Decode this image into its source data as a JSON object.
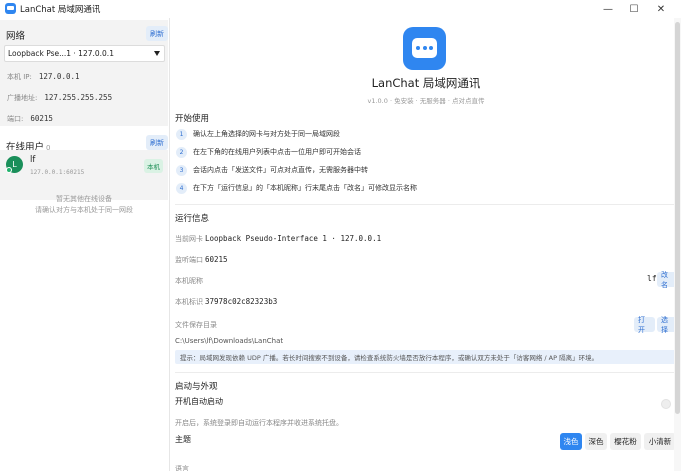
{
  "window": {
    "title": "LanChat 局域网通讯",
    "min_glyph": "—",
    "max_glyph": "☐",
    "close_glyph": "✕"
  },
  "colors": {
    "accent": "#2f86f0",
    "online": "#23b36e",
    "tip_bg": "#e8f0fb"
  },
  "icons": {
    "app": "chat-bubble-icon",
    "dropdown": "caret-down-icon"
  },
  "sidebar": {
    "network": {
      "title": "网络",
      "refresh": "刷新",
      "selected_interface": "Loopback Pse...1 · 127.0.0.1",
      "local_ip_label": "本机 IP:",
      "local_ip": "127.0.0.1",
      "broadcast_label": "广播地址:",
      "broadcast": "127.255.255.255",
      "port_label": "端口:",
      "port": "60215"
    },
    "online": {
      "title": "在线用户",
      "count": "0",
      "refresh": "刷新",
      "user": {
        "avatar_letter": "L",
        "name": "lf",
        "address": "127.0.0.1:60215",
        "badge": "本机"
      },
      "empty_line1": "暂无其他在线设备",
      "empty_line2": "请确认对方与本机处于同一网段"
    }
  },
  "main": {
    "app_name": "LanChat 局域网通讯",
    "version_line": "v1.0.0 · 免安装 · 无服务器 · 点对点直传",
    "getting_started": {
      "title": "开始使用",
      "steps": [
        {
          "num": "1",
          "text": "确认左上角选择的网卡与对方处于同一局域网段"
        },
        {
          "num": "2",
          "text": "在左下角的在线用户列表中点击一位用户即可开始会话"
        },
        {
          "num": "3",
          "text": "会话内点击「发送文件」可点对点直传，无需服务器中转"
        },
        {
          "num": "4",
          "text": "在下方「运行信息」的「本机昵称」行末尾点击「改名」可修改显示名称"
        }
      ]
    },
    "runtime": {
      "title": "运行信息",
      "nic_label": "当前网卡",
      "nic_value": "Loopback Pseudo-Interface 1 · 127.0.0.1",
      "port_label": "监听端口",
      "port_value": "60215",
      "nickname_label": "本机昵称",
      "nickname_value": "lf",
      "rename": "改名",
      "id_label": "本机标识",
      "id_value": "37978c02c82323b3",
      "save_dir_label": "文件保存目录",
      "save_dir_value": "C:\\Users\\lf\\Downloads\\LanChat",
      "open": "打开",
      "choose": "选择",
      "tip": "提示：局域网发现依赖 UDP 广播。若长时间搜索不到设备，请检查系统防火墙是否放行本程序，或确认双方未处于「访客网络 / AP 隔离」环境。"
    },
    "startup": {
      "title": "启动与外观",
      "autostart_label": "开机自动启动",
      "autostart_desc": "开启后，系统登录即自动运行本程序并收进系统托盘。",
      "theme_label": "主题",
      "themes": [
        "浅色",
        "深色",
        "樱花粉",
        "小清新"
      ],
      "active_theme": "浅色",
      "cut_label": "语言"
    }
  }
}
